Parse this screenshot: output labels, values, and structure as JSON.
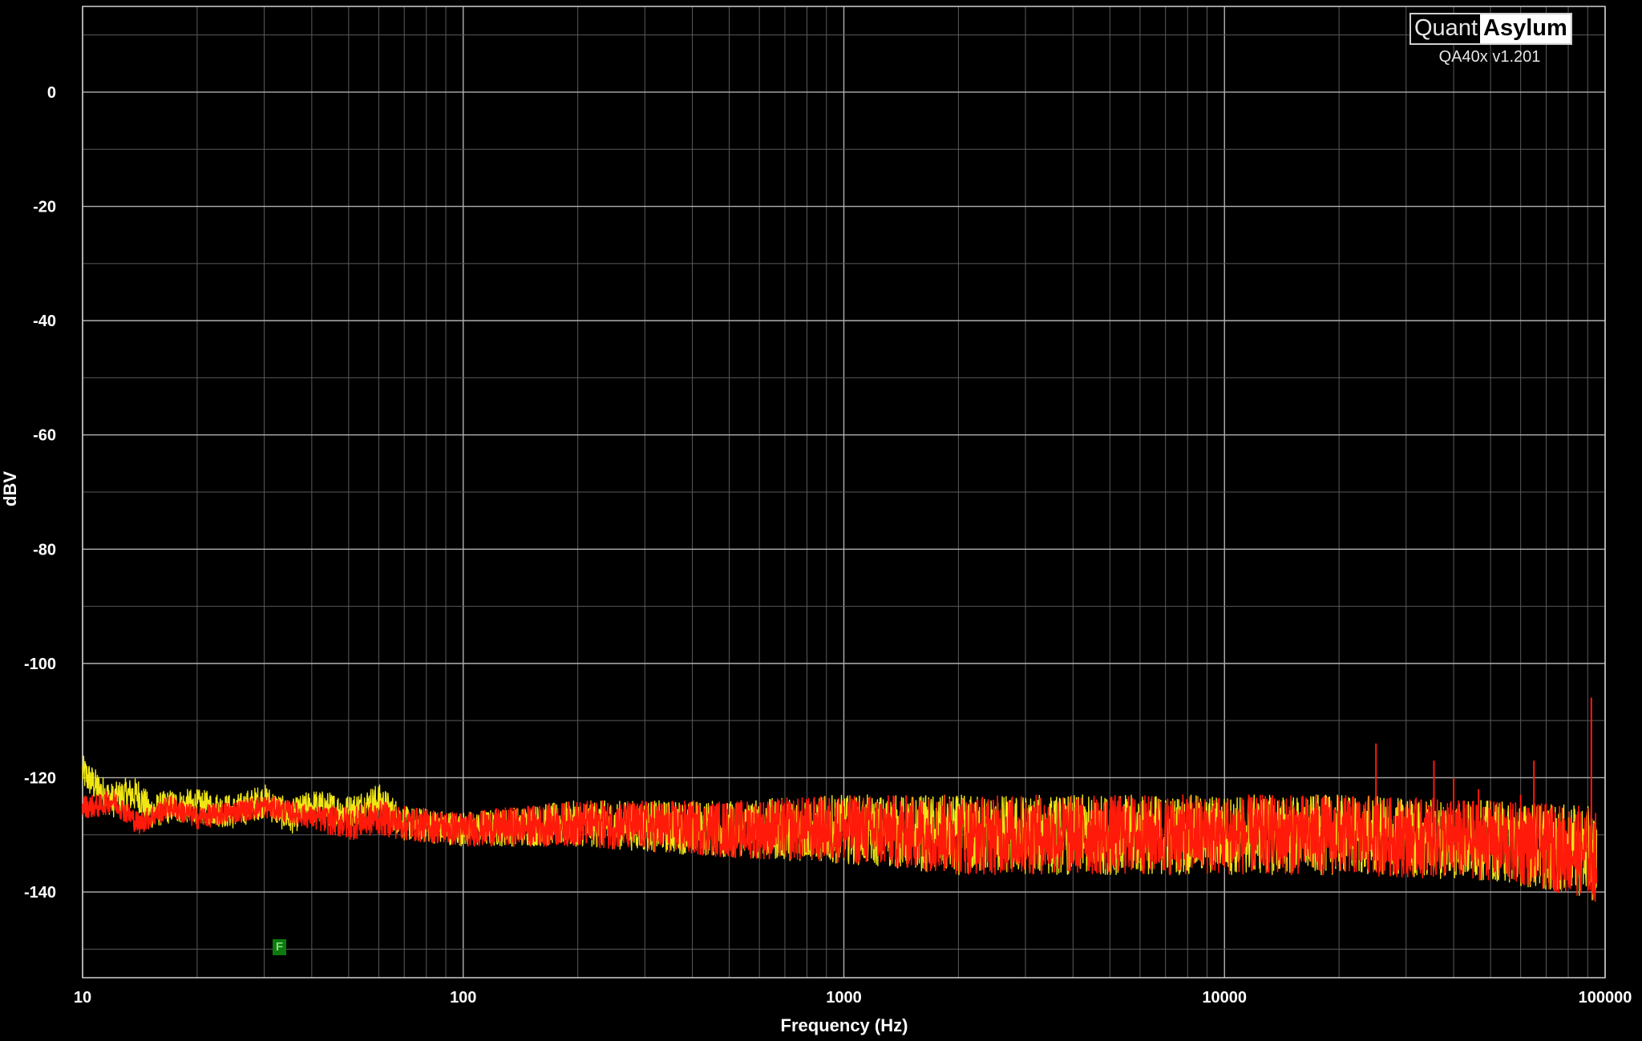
{
  "brand": {
    "quant": "Quant",
    "asylum": "Asylum",
    "version": "QA40x v1.201"
  },
  "marker_label": "F",
  "colors": {
    "background": "#000000",
    "grid": "#5a5a5a",
    "grid_major": "#b0b0b0",
    "series_yellow": "#f0e614",
    "series_red": "#ff1a0a",
    "marker": "#0d7a0d"
  },
  "chart_data": {
    "type": "line",
    "title": "",
    "xlabel": "Frequency (Hz)",
    "ylabel": "dBV",
    "xscale": "log",
    "xlim": [
      10,
      100000
    ],
    "ylim": [
      -155,
      15
    ],
    "xticks": [
      "10",
      "100",
      "1000",
      "10000",
      "100000"
    ],
    "yticks": [
      "0",
      "-20",
      "-40",
      "-60",
      "-80",
      "-100",
      "-120",
      "-140"
    ],
    "grid": true,
    "series": [
      {
        "color": "#f0e614",
        "x": [
          10,
          11,
          12,
          13,
          14,
          15,
          17,
          20,
          25,
          30,
          35,
          40,
          50,
          60,
          70,
          100,
          200,
          500,
          1000,
          2000,
          5000,
          10000,
          20000,
          50000,
          90000,
          95000
        ],
        "y": [
          -119,
          -122,
          -124,
          -123,
          -123,
          -126,
          -125,
          -125,
          -126,
          -124,
          -127,
          -125,
          -126,
          -124,
          -128,
          -129,
          -128,
          -129,
          -129,
          -130,
          -130,
          -130,
          -130,
          -131,
          -133,
          -134
        ],
        "noise_band_db": [
          3,
          3,
          3,
          3,
          3,
          3,
          3,
          3,
          3,
          3,
          3,
          3,
          3,
          3,
          3,
          3,
          4,
          5,
          6,
          7,
          7,
          7,
          7,
          7,
          8,
          8
        ]
      },
      {
        "color": "#ff1a0a",
        "x": [
          10,
          11,
          12,
          13,
          14,
          15,
          17,
          20,
          25,
          30,
          35,
          40,
          50,
          60,
          70,
          100,
          200,
          500,
          1000,
          2000,
          5000,
          10000,
          20000,
          50000,
          90000,
          95000
        ],
        "y": [
          -125,
          -125,
          -124,
          -126,
          -128,
          -127,
          -125,
          -127,
          -126,
          -125,
          -126,
          -127,
          -128,
          -127,
          -128,
          -129,
          -128,
          -129,
          -129,
          -130,
          -130,
          -130,
          -130,
          -131,
          -133,
          -134
        ],
        "noise_band_db": [
          2,
          2,
          2,
          2,
          2,
          2,
          2,
          2,
          2,
          2,
          2,
          2,
          3,
          3,
          3,
          3,
          4,
          5,
          6,
          7,
          7,
          7,
          7,
          7,
          8,
          8
        ],
        "spurs": [
          {
            "x": 25000,
            "y": -114
          },
          {
            "x": 35500,
            "y": -117
          },
          {
            "x": 40000,
            "y": -120
          },
          {
            "x": 46500,
            "y": -122
          },
          {
            "x": 60000,
            "y": -123
          },
          {
            "x": 65000,
            "y": -117
          },
          {
            "x": 92000,
            "y": -106
          }
        ]
      }
    ]
  }
}
